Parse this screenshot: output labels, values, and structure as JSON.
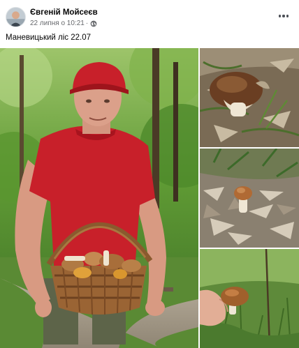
{
  "post": {
    "author_name": "Євгеній Мойсеєв",
    "date": "22 липня о 10:21",
    "separator": "·",
    "visibility_icon": "globe-icon",
    "more_icon": "more-options-icon",
    "text": "Маневицький ліс 22.07"
  },
  "photos": [
    {
      "subject": "man in red t-shirt holding wicker basket of mushrooms in forest"
    },
    {
      "subject": "porcini mushroom among leaves"
    },
    {
      "subject": "small mushroom in leaf litter"
    },
    {
      "subject": "hand near mushroom in grass"
    }
  ],
  "colors": {
    "text_primary": "#050505",
    "text_secondary": "#65676b",
    "shirt_red": "#c8202a",
    "forest_green": "#4e8a2e"
  }
}
